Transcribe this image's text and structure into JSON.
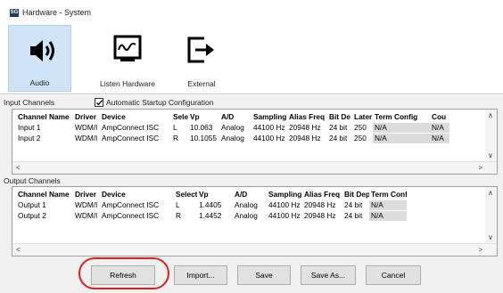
{
  "window": {
    "title": "Hardware - System",
    "icon_text": "SG"
  },
  "toolbar": [
    {
      "label": "Audio",
      "icon": "speaker-icon"
    },
    {
      "label": "Listen Hardware",
      "icon": "monitor-waveform-icon"
    },
    {
      "label": "External",
      "icon": "export-icon"
    }
  ],
  "input_section": {
    "label": "Input Channels",
    "auto_startup_label": "Automatic Startup Configuration",
    "auto_startup_checked": true,
    "columns": [
      "Channel Name",
      "Driver",
      "Device",
      "Sele",
      "Vp",
      "A/D",
      "Sampling",
      "Alias Freq",
      "Bit De",
      "Later",
      "Term Config",
      "Cou"
    ],
    "rows": [
      [
        "Input 1",
        "WDM/I",
        "AmpConnect ISC",
        "L",
        "10.063",
        "Analog",
        "44100 Hz",
        "20948 Hz",
        "24 bit",
        "250",
        "N/A",
        "N/A"
      ],
      [
        "Input 2",
        "WDM/I",
        "AmpConnect ISC",
        "R",
        "10.1055",
        "Analog",
        "44100 Hz",
        "20948 Hz",
        "24 bit",
        "250",
        "N/A",
        "N/A"
      ]
    ]
  },
  "output_section": {
    "label": "Output Channels",
    "columns": [
      "Channel Name",
      "Driver",
      "Device",
      "Select",
      "Vp",
      "A/D",
      "Sampling",
      "Alias Freq",
      "Bit Dep",
      "Term Conf"
    ],
    "rows": [
      [
        "Output 1",
        "WDM/I",
        "AmpConnect ISC",
        "L",
        "1.4405",
        "Analog",
        "44100 Hz",
        "20948 Hz",
        "24 bit",
        "N/A"
      ],
      [
        "Output 2",
        "WDM/I",
        "AmpConnect ISC",
        "R",
        "1.4452",
        "Analog",
        "44100 Hz",
        "20948 Hz",
        "24 bit",
        "N/A"
      ]
    ]
  },
  "buttons": {
    "refresh": "Refresh",
    "import": "Import...",
    "save": "Save",
    "save_as": "Save As...",
    "cancel": "Cancel"
  },
  "colors": {
    "highlight_circle": "#e0201c",
    "active_tool_bg": "#cfe4f7"
  }
}
